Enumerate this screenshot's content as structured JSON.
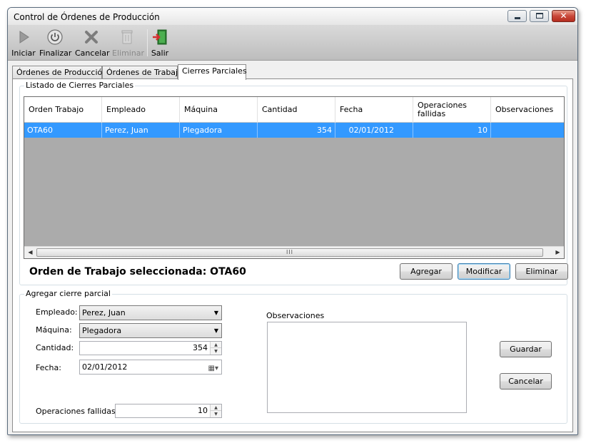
{
  "window": {
    "title": "Control de Órdenes de Producción",
    "controls": {
      "close": "✕"
    }
  },
  "toolbar": {
    "buttons": [
      {
        "label": "Iniciar",
        "icon": "play-icon",
        "enabled": true
      },
      {
        "label": "Finalizar",
        "icon": "power-icon",
        "enabled": true
      },
      {
        "label": "Cancelar",
        "icon": "cancel-x-icon",
        "enabled": true
      },
      {
        "label": "Eliminar",
        "icon": "trash-icon",
        "enabled": false
      },
      {
        "label": "Salir",
        "icon": "exit-door-icon",
        "enabled": true
      }
    ]
  },
  "tabs": [
    {
      "label": "Órdenes de Producción",
      "active": false
    },
    {
      "label": "Órdenes de Trabajo",
      "active": false
    },
    {
      "label": "Cierres Parciales",
      "active": true
    }
  ],
  "listado": {
    "title": "Listado de Cierres Parciales",
    "columns": [
      "Orden Trabajo",
      "Empleado",
      "Máquina",
      "Cantidad",
      "Fecha",
      "Operaciones fallidas",
      "Observaciones"
    ],
    "rows": [
      {
        "orden": "OTA60",
        "empleado": "Perez, Juan",
        "maquina": "Plegadora",
        "cantidad": "354",
        "fecha": "02/01/2012",
        "fallidas": "10",
        "observaciones": ""
      }
    ],
    "scroll_grip": "III",
    "selected_caption": "Orden de Trabajo seleccionada: OTA60",
    "buttons": {
      "agregar": "Agregar",
      "modificar": "Modificar",
      "eliminar": "Eliminar"
    }
  },
  "form": {
    "title": "Agregar cierre parcial",
    "empleado_label": "Empleado:",
    "empleado_value": "Perez, Juan",
    "maquina_label": "Máquina:",
    "maquina_value": "Plegadora",
    "cantidad_label": "Cantidad:",
    "cantidad_value": "354",
    "fecha_label": "Fecha:",
    "fecha_value": "02/01/2012",
    "fallidas_label": "Operaciones fallidas:",
    "fallidas_value": "10",
    "observaciones_label": "Observaciones",
    "guardar": "Guardar",
    "cancelar": "Cancelar"
  },
  "colors": {
    "selection": "#3399ff",
    "grid_empty": "#ababab",
    "toolbar": "#c9c9c9"
  }
}
